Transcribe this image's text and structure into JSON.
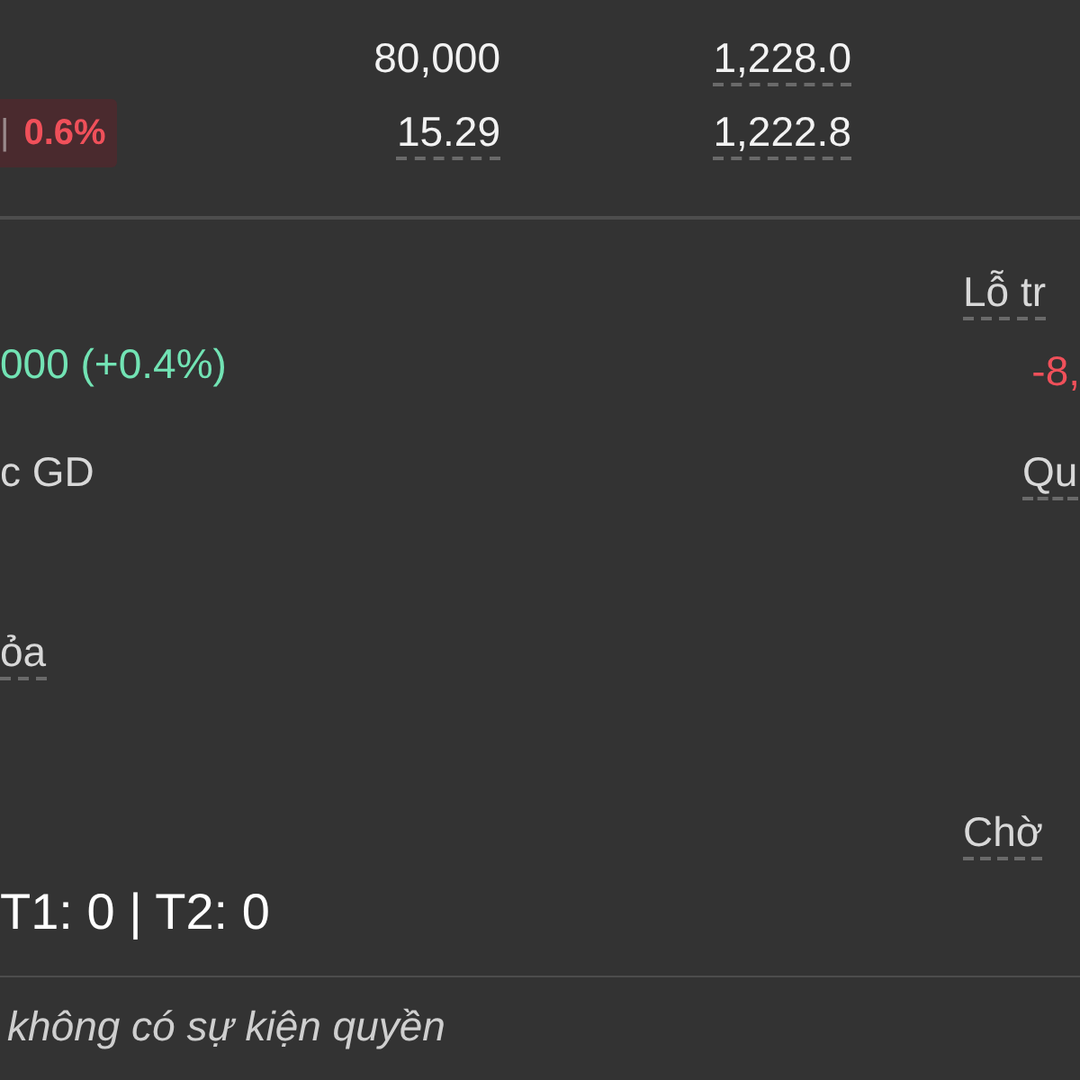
{
  "quote_rows": [
    {
      "change": null,
      "volume": {
        "text": "80,000",
        "has_tooltip": false
      },
      "price": {
        "text": "1,228.0",
        "has_tooltip": true
      }
    },
    {
      "change": {
        "separator": "|",
        "text": "0.6%"
      },
      "volume": {
        "text": "15.29",
        "has_tooltip": true
      },
      "price": {
        "text": "1,222.8",
        "has_tooltip": true
      }
    }
  ],
  "left_column": [
    {
      "text": "000 (+0.4%)",
      "kind": "up",
      "has_tooltip": false
    },
    {
      "text": "c GD",
      "kind": "label",
      "has_tooltip": false
    },
    {
      "text": "ỏa",
      "kind": "label",
      "has_tooltip": true
    },
    {
      "text": "T1: 0 | T2: 0",
      "kind": "value",
      "has_tooltip": false
    }
  ],
  "right_column": [
    {
      "text": "Lỗ tr",
      "kind": "label",
      "has_tooltip": true
    },
    {
      "text": "-8,",
      "kind": "down",
      "has_tooltip": false
    },
    {
      "text": "Qu",
      "kind": "label",
      "has_tooltip": true
    },
    {
      "text": "Chờ",
      "kind": "label",
      "has_tooltip": true
    }
  ],
  "footer_note": "không có sự kiện quyền"
}
